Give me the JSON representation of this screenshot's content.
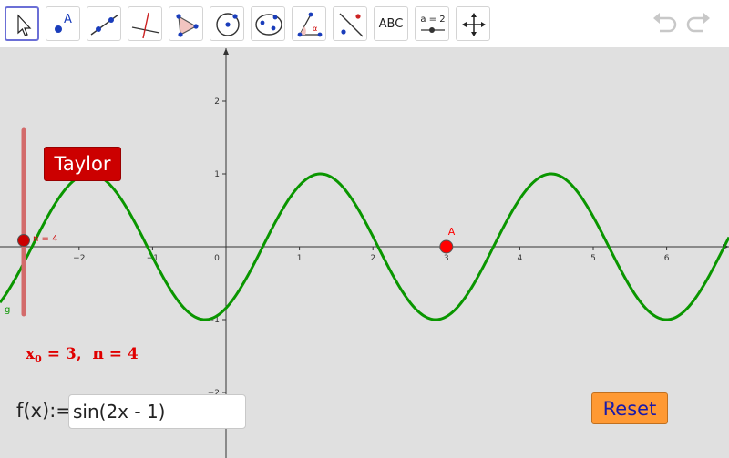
{
  "toolbar": {
    "tools": [
      {
        "name": "move-tool",
        "icon": "arrow-cursor-icon"
      },
      {
        "name": "point-tool",
        "icon": "point-icon",
        "label": "A"
      },
      {
        "name": "line-tool",
        "icon": "line-icon"
      },
      {
        "name": "perpendicular-line-tool",
        "icon": "perpendicular-line-icon"
      },
      {
        "name": "polygon-tool",
        "icon": "polygon-icon"
      },
      {
        "name": "circle-center-tool",
        "icon": "circle-icon"
      },
      {
        "name": "conic-tool",
        "icon": "ellipse-icon"
      },
      {
        "name": "angle-tool",
        "icon": "angle-icon",
        "label": "α"
      },
      {
        "name": "reflect-tool",
        "icon": "reflect-icon"
      },
      {
        "name": "text-tool",
        "icon": "text-icon",
        "label": "ABC"
      },
      {
        "name": "slider-tool",
        "icon": "slider-icon",
        "label": "a = 2"
      },
      {
        "name": "move-graphics-view-tool",
        "icon": "move-graphics-view-icon"
      }
    ],
    "undo_icon": "undo-icon",
    "redo_icon": "redo-icon"
  },
  "graphics": {
    "background": "#e0e0e0",
    "x_axis_ticks": [
      "−2",
      "−1",
      "0",
      "1",
      "2",
      "3",
      "4",
      "5",
      "6"
    ],
    "y_axis_ticks": [
      "2",
      "1",
      "−1",
      "−2"
    ],
    "function": {
      "label": "g",
      "color": "#0a9600",
      "expression": "sin(2x - 1)"
    },
    "point": {
      "label": "A",
      "x": 3,
      "y": 0,
      "color": "#ff0000"
    },
    "slider": {
      "label": "n = 4",
      "value": 4,
      "color": "#d36b6b"
    }
  },
  "buttons": {
    "taylor_label": "Taylor",
    "reset_label": "Reset"
  },
  "input": {
    "prefix": "f(x):=",
    "value": "sin(2x - 1)"
  },
  "status": {
    "x_symbol": "x",
    "x_subscript": "0",
    "x_value": " = 3,  ",
    "n_text": "n = 4"
  }
}
